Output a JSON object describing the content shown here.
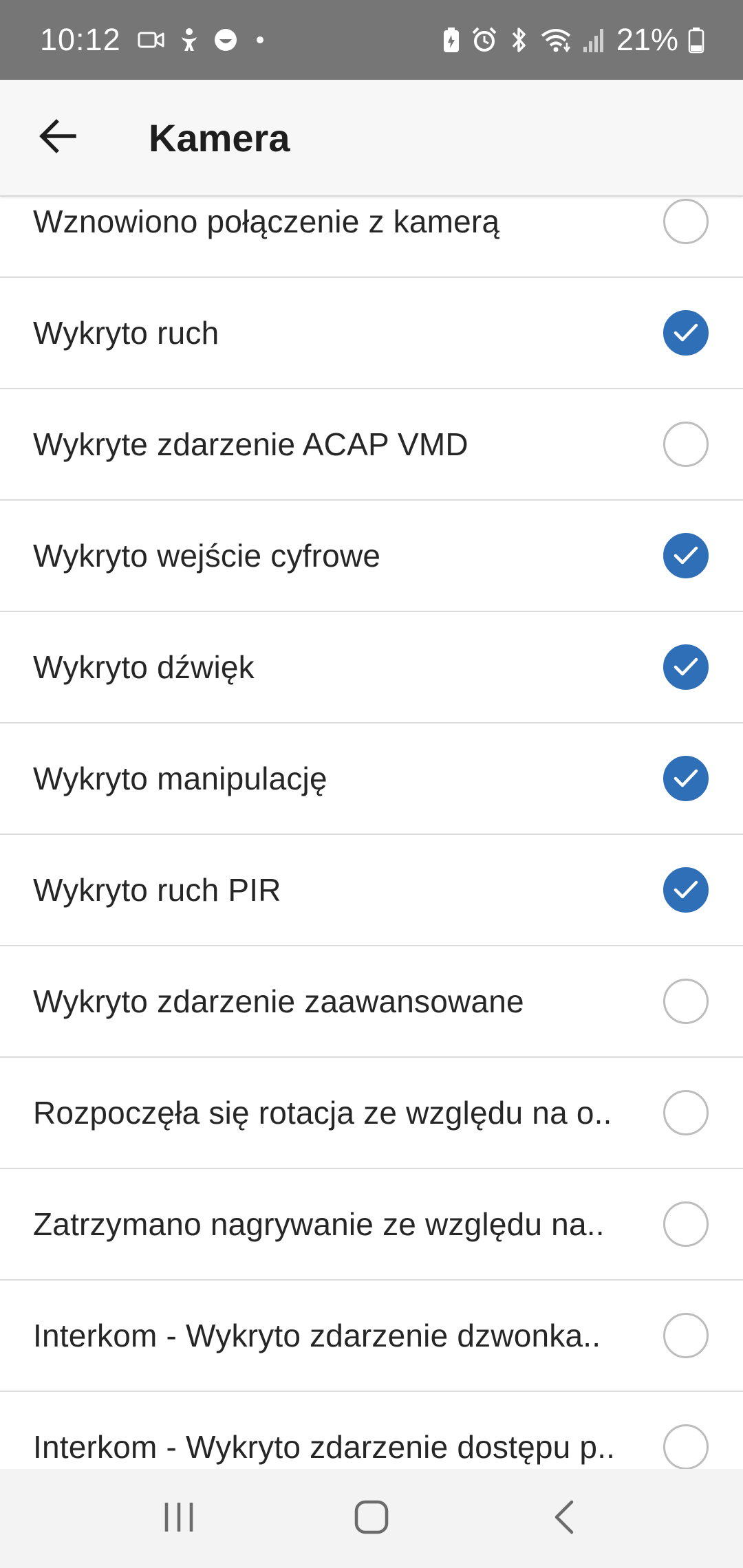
{
  "status_bar": {
    "time": "10:12",
    "battery_percent": "21%",
    "icons_left": [
      "video-call-icon",
      "accessibility-icon",
      "face-icon",
      "dot-icon"
    ],
    "icons_right": [
      "battery-saver-icon",
      "alarm-icon",
      "bluetooth-icon",
      "wifi-icon",
      "signal-icon",
      "battery-icon"
    ]
  },
  "app_bar": {
    "title": "Kamera",
    "back_icon": "arrow-left-icon"
  },
  "colors": {
    "status_bar_bg": "#767676",
    "checked": "#2f6fb7",
    "unchecked_border": "#bdbdbd"
  },
  "list": {
    "items": [
      {
        "label": "Wznowiono połączenie z kamerą",
        "checked": false
      },
      {
        "label": "Wykryto ruch",
        "checked": true
      },
      {
        "label": "Wykryte zdarzenie ACAP VMD",
        "checked": false
      },
      {
        "label": "Wykryto wejście cyfrowe",
        "checked": true
      },
      {
        "label": "Wykryto dźwięk",
        "checked": true
      },
      {
        "label": "Wykryto manipulację",
        "checked": true
      },
      {
        "label": "Wykryto ruch PIR",
        "checked": true
      },
      {
        "label": "Wykryto zdarzenie zaawansowane",
        "checked": false
      },
      {
        "label": "Rozpoczęła się rotacja ze względu na o..",
        "checked": false
      },
      {
        "label": "Zatrzymano nagrywanie ze względu na..",
        "checked": false
      },
      {
        "label": "Interkom - Wykryto zdarzenie dzwonka..",
        "checked": false
      },
      {
        "label": "Interkom - Wykryto zdarzenie dostępu p..",
        "checked": false
      }
    ]
  },
  "nav_bar": {
    "buttons": [
      "recent-apps-icon",
      "home-icon",
      "back-icon"
    ]
  }
}
